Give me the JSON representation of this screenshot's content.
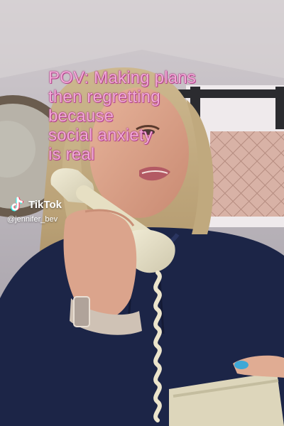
{
  "caption": {
    "lines": [
      "POV: Making plans",
      "then regretting",
      "because",
      "social anxiety",
      "is real"
    ]
  },
  "watermark": {
    "brand": "TikTok",
    "handle": "@jennifer_bev",
    "logo_icon": "tiktok-logo-icon"
  },
  "colors": {
    "caption_text": "#f2a9d8",
    "caption_glow": "#a0307a",
    "hoodie": "#1c2547"
  }
}
